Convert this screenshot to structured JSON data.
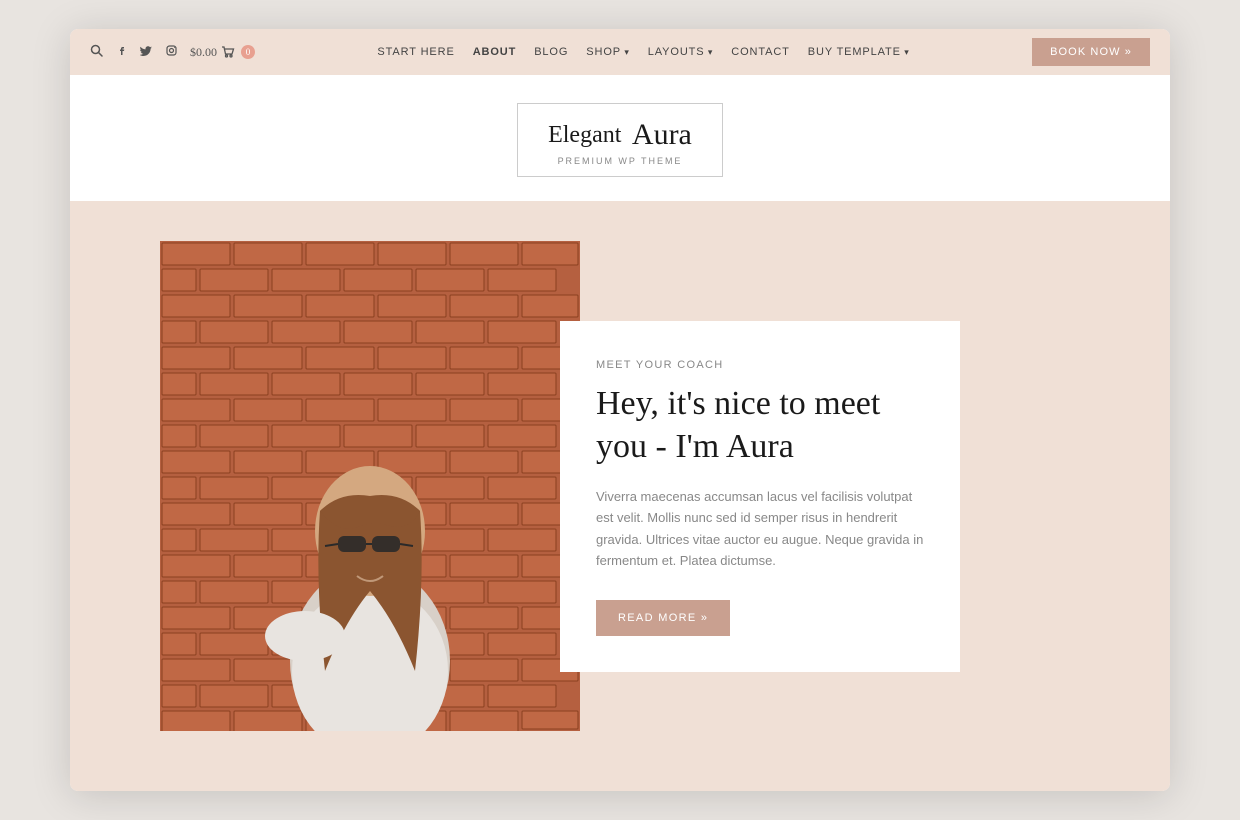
{
  "browser": {
    "shadow": true
  },
  "topbar": {
    "price": "$0.00",
    "cart_count": "0",
    "nav_items": [
      {
        "label": "START HERE",
        "active": false,
        "has_arrow": false
      },
      {
        "label": "ABOUT",
        "active": true,
        "has_arrow": false
      },
      {
        "label": "BLOG",
        "active": false,
        "has_arrow": false
      },
      {
        "label": "SHOP",
        "active": false,
        "has_arrow": true
      },
      {
        "label": "LAYOUTS",
        "active": false,
        "has_arrow": true
      },
      {
        "label": "CONTACT",
        "active": false,
        "has_arrow": false
      },
      {
        "label": "BUY TEMPLATE",
        "active": false,
        "has_arrow": true
      }
    ],
    "book_now": "BOOK NOW »"
  },
  "logo": {
    "title_serif": "Elegant",
    "title_script": "Aura",
    "subtitle": "PREMIUM WP THEME"
  },
  "hero": {
    "meet_label": "MEET YOUR COACH",
    "headline": "Hey, it's nice to meet you - I'm Aura",
    "body": "Viverra maecenas accumsan lacus vel facilisis volutpat est velit. Mollis nunc sed id semper risus in hendrerit gravida. Ultrices vitae auctor eu augue. Neque gravida in fermentum et. Platea dictumse.",
    "read_more": "READ MORE »"
  }
}
